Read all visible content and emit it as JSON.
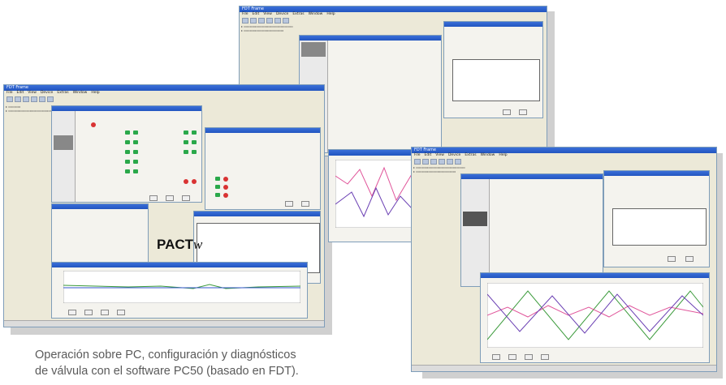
{
  "caption": {
    "line1": "Operación sobre PC, configuración y diagnósticos",
    "line2": "de válvula con el software PC50 (basado en FDT)."
  },
  "logo": {
    "text": "PACT",
    "suffix": "w"
  },
  "windows": {
    "left_title": "FDT Frame",
    "mid_title": "FDT Frame",
    "right_title": "FDT Frame",
    "menu": [
      "File",
      "Edit",
      "View",
      "Device",
      "Extras",
      "Window",
      "Help"
    ]
  },
  "colors": {
    "accent": "#f5c400",
    "blob": "#2a8bcf",
    "titlebar": "#2255c0"
  }
}
